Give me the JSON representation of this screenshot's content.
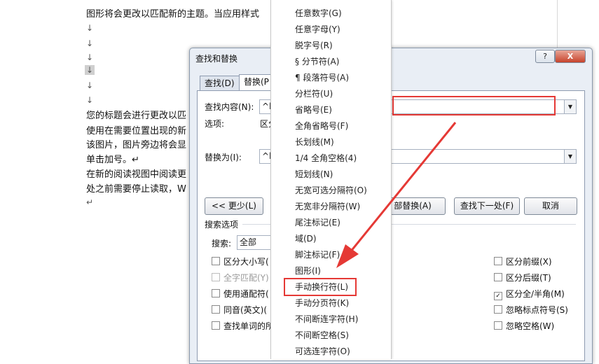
{
  "document": {
    "lines": [
      "图形将会更改以匹配新的主题。当应用样式",
      "您的标题会进行更改以匹",
      "使用在需要位置出现的新",
      "该图片，图片旁边将会显",
      "单击加号。↵",
      "在新的阅读视图中阅读更",
      "处之前需要停止读取，W"
    ],
    "marks": [
      "↓",
      "↓",
      "↓",
      "↓",
      "↓",
      "↓",
      "↵"
    ]
  },
  "dialog": {
    "title": "查找和替换",
    "help_label": "?",
    "close_label": "X",
    "tabs": [
      "查找(D)",
      "替换(P"
    ],
    "find_label": "查找内容(N):",
    "find_value": "^l",
    "options_label": "选项:",
    "options_value": "区分",
    "replace_label": "替换为(I):",
    "replace_value": "^l",
    "less_button": "<< 更少(L)",
    "replace_all_button": "部替换(A)",
    "find_next_button": "查找下一处(F)",
    "cancel_button": "取消",
    "search_options_heading": "搜索选项",
    "search_label": "搜索:",
    "search_value": "全部",
    "left_checks": [
      {
        "label": "区分大小写(",
        "checked": false,
        "disabled": false
      },
      {
        "label": "全字匹配(Y)",
        "checked": false,
        "disabled": true
      },
      {
        "label": "使用通配符(",
        "checked": false,
        "disabled": false
      },
      {
        "label": "同音(英文)(",
        "checked": false,
        "disabled": false
      },
      {
        "label": "查找单词的所",
        "checked": false,
        "disabled": false
      }
    ],
    "right_checks": [
      {
        "label": "区分前缀(X)",
        "checked": false
      },
      {
        "label": "区分后缀(T)",
        "checked": false
      },
      {
        "label": "区分全/半角(M)",
        "checked": true
      },
      {
        "label": "忽略标点符号(S)",
        "checked": false
      },
      {
        "label": "忽略空格(W)",
        "checked": false
      }
    ]
  },
  "menu": {
    "items": [
      "任意数字(G)",
      "任意字母(Y)",
      "脱字号(R)",
      "§ 分节符(A)",
      "¶ 段落符号(A)",
      "分栏符(U)",
      "省略号(E)",
      "全角省略号(F)",
      "长划线(M)",
      "1/4 全角空格(4)",
      "短划线(N)",
      "无宽可选分隔符(O)",
      "无宽非分隔符(W)",
      "尾注标记(E)",
      "域(D)",
      "脚注标记(F)",
      "图形(I)",
      "手动换行符(L)",
      "手动分页符(K)",
      "不间断连字符(H)",
      "不间断空格(S)",
      "可选连字符(O)"
    ],
    "highlighted_index": 17
  },
  "colors": {
    "annotation": "#e53935"
  }
}
